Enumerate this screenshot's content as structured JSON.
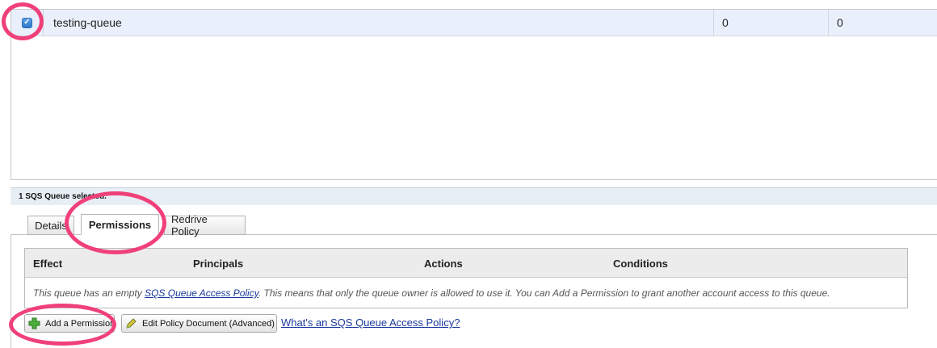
{
  "queue_table": {
    "rows": [
      {
        "name": "testing-queue",
        "col3": "0",
        "col4": "0",
        "selected": true
      }
    ]
  },
  "selection_status": "1 SQS Queue selected.",
  "tabs": [
    {
      "label": "Details",
      "active": false
    },
    {
      "label": "Permissions",
      "active": true
    },
    {
      "label": "Redrive Policy",
      "active": false
    }
  ],
  "permissions": {
    "headers": [
      "Effect",
      "Principals",
      "Actions",
      "Conditions"
    ],
    "empty_msg_pre": "This queue has an empty ",
    "empty_msg_link": "SQS Queue Access Policy",
    "empty_msg_post": ". This means that only the queue owner is allowed to use it. You can Add a Permission to grant another account access to this queue."
  },
  "buttons": {
    "add_permission": "Add a Permission",
    "edit_policy": "Edit Policy Document (Advanced)"
  },
  "help_link": "What's an SQS Queue Access Policy?",
  "icons": {
    "add": "plus-icon",
    "edit": "pencil-icon",
    "checkbox": "checkmark-icon"
  },
  "colors": {
    "highlight": "#f0407a",
    "link": "#1a3a9c",
    "selected_row": "#e9f0fb"
  }
}
